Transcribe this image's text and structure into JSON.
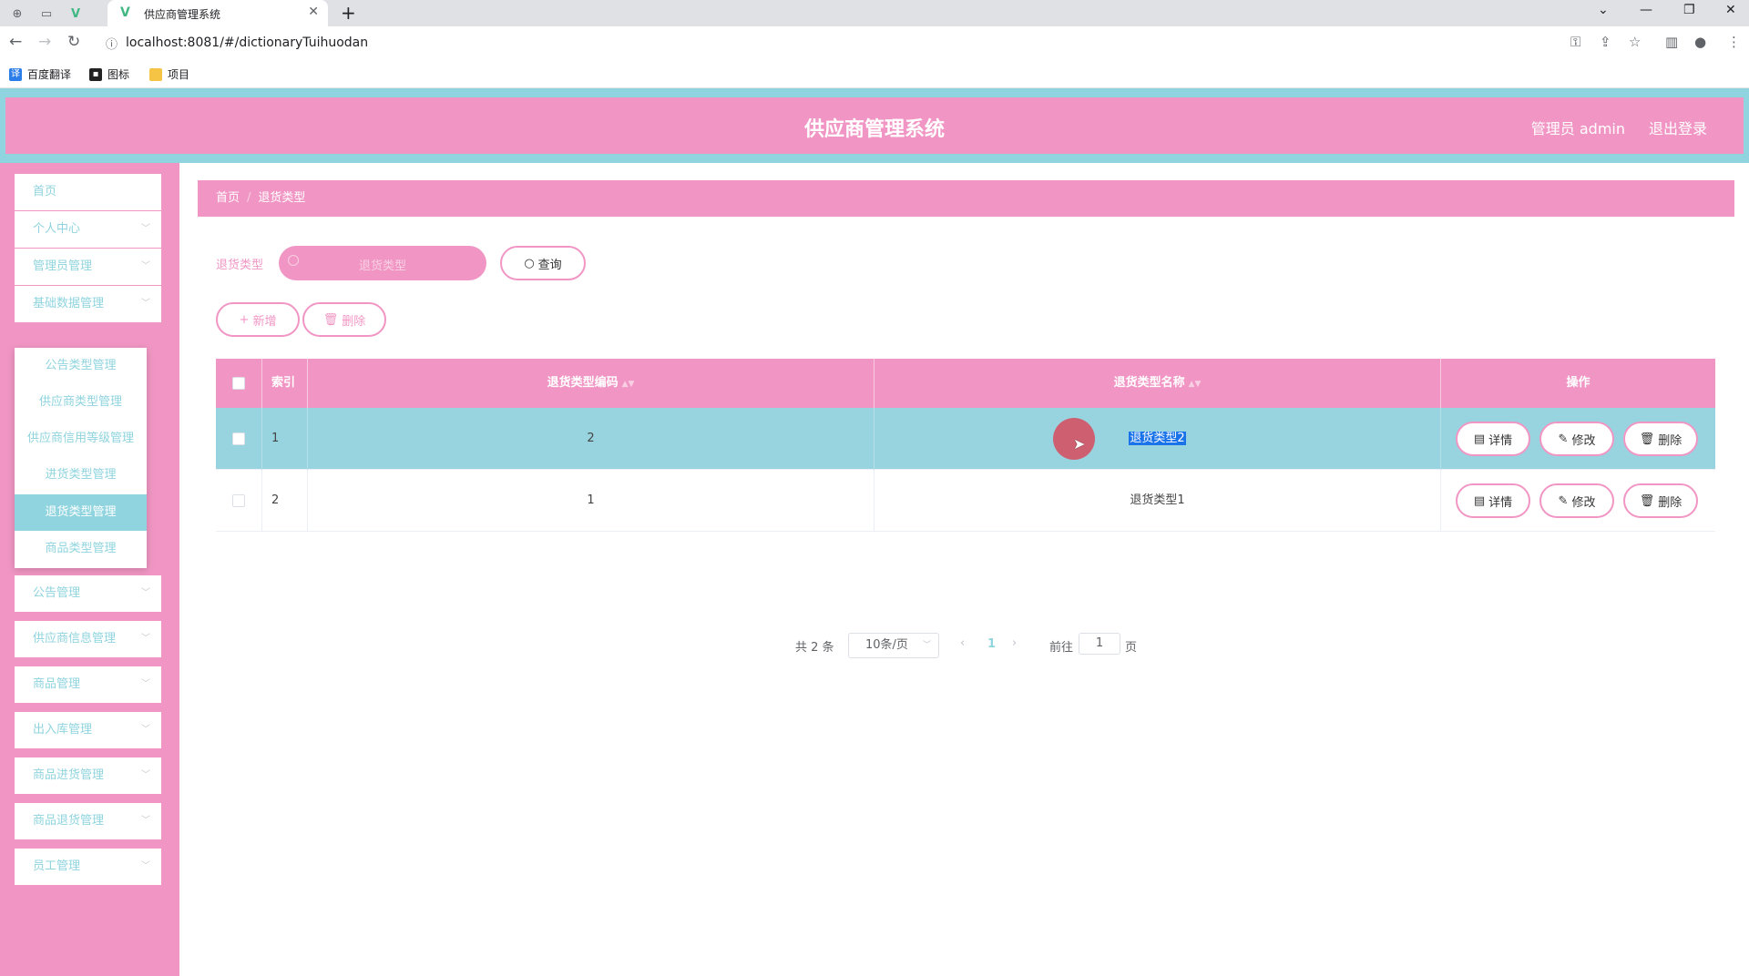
{
  "browser": {
    "tab_title": "供应商管理系统",
    "url": "localhost:8081/#/dictionaryTuihuodan",
    "bookmarks": [
      "百度翻译",
      "图标",
      "项目"
    ]
  },
  "header": {
    "title": "供应商管理系统",
    "user": "管理员 admin",
    "logout": "退出登录"
  },
  "sidebar": {
    "items": [
      "首页",
      "个人中心",
      "管理员管理",
      "基础数据管理",
      "公告管理",
      "供应商信息管理",
      "商品管理",
      "出入库管理",
      "商品进货管理",
      "商品退货管理",
      "员工管理"
    ],
    "submenu": [
      "公告类型管理",
      "供应商类型管理",
      "供应商信用等级管理",
      "进货类型管理",
      "退货类型管理",
      "商品类型管理"
    ],
    "active_sub": "退货类型管理"
  },
  "breadcrumb": {
    "home": "首页",
    "current": "退货类型"
  },
  "search": {
    "label": "退货类型",
    "placeholder": "退货类型",
    "button": "查询"
  },
  "actions": {
    "add": "新增",
    "delete": "删除"
  },
  "table": {
    "headers": {
      "index": "索引",
      "code": "退货类型编码",
      "name": "退货类型名称",
      "ops": "操作"
    },
    "rows": [
      {
        "index": "1",
        "code": "2",
        "name": "退货类型2"
      },
      {
        "index": "2",
        "code": "1",
        "name": "退货类型1"
      }
    ],
    "row_actions": {
      "detail": "详情",
      "edit": "修改",
      "delete": "删除"
    }
  },
  "pagination": {
    "total": "共 2 条",
    "page_size": "10条/页",
    "current_page": "1",
    "goto_label": "前往",
    "goto_value": "1",
    "page_suffix": "页"
  },
  "colors": {
    "accent": "#f196c4",
    "teal": "#8fd4de"
  }
}
